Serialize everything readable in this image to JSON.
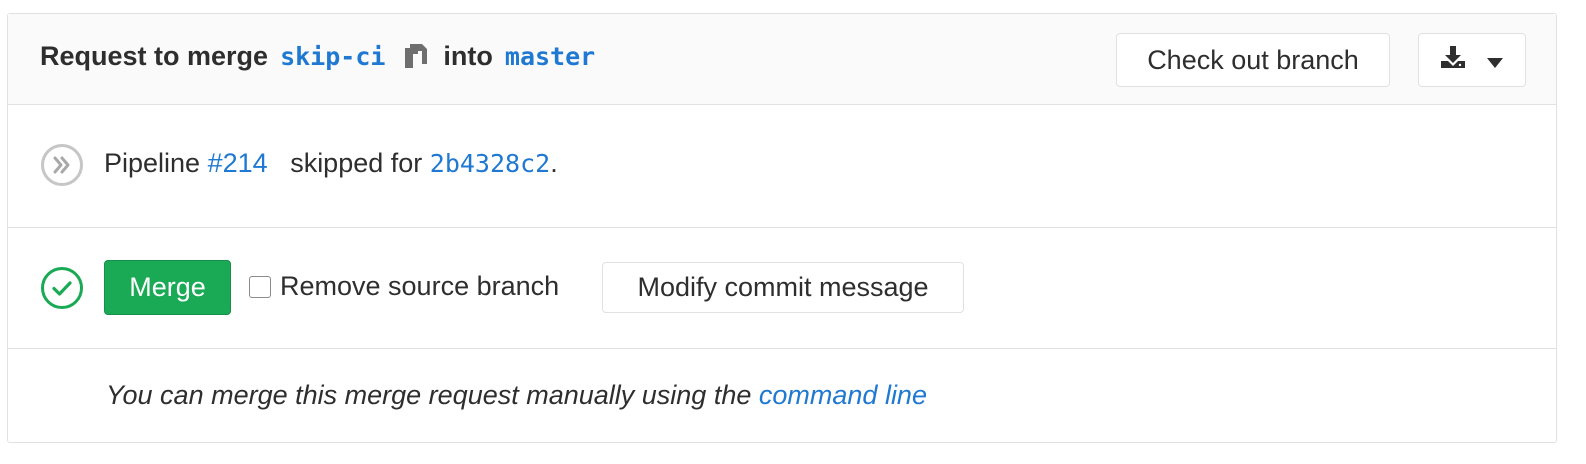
{
  "header": {
    "prefix": "Request to merge",
    "source_branch": "skip-ci",
    "middle": "into",
    "target_branch": "master",
    "checkout_label": "Check out branch"
  },
  "pipeline": {
    "prefix": "Pipeline",
    "id": "#214",
    "middle": "skipped for",
    "commit": "2b4328c2",
    "suffix": "."
  },
  "merge": {
    "button_label": "Merge",
    "remove_source_label": "Remove source branch",
    "modify_commit_label": "Modify commit message"
  },
  "footer": {
    "text": "You can merge this merge request manually using the",
    "link": "command line"
  },
  "icons": {
    "skipped": "pipeline-skipped-icon",
    "success": "check-circle-icon",
    "copy": "copy-icon",
    "download": "download-icon",
    "caret": "caret-down-icon"
  },
  "colors": {
    "link": "#1f78d1",
    "merge_button": "#1aaa55",
    "success": "#1aaa55",
    "skipped": "#bfbfbf"
  }
}
